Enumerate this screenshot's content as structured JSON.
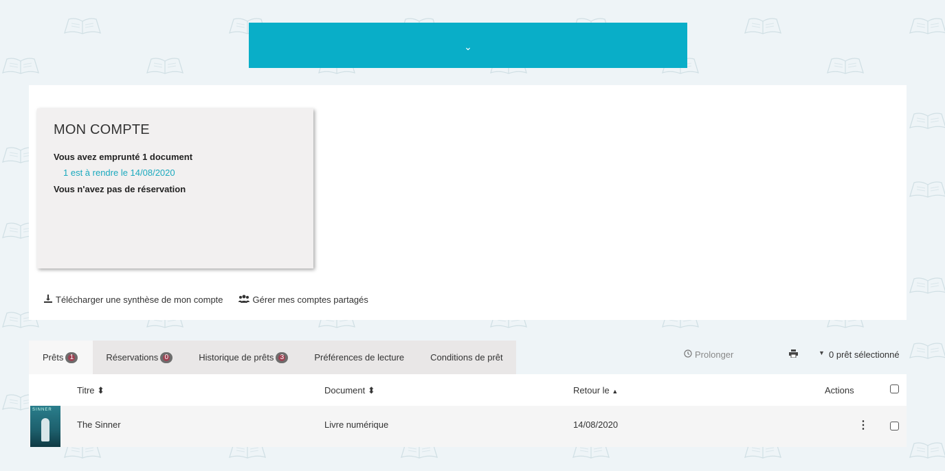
{
  "account": {
    "title": "MON COMPTE",
    "borrowed": "Vous avez emprunté 1 document",
    "due": "1 est à rendre le 14/08/2020",
    "reservations": "Vous n'avez pas de réservation"
  },
  "links": {
    "download": "Télécharger une synthèse de mon compte",
    "shared": "Gérer mes comptes partagés"
  },
  "tabs": [
    {
      "label": "Prêts",
      "badge": "1"
    },
    {
      "label": "Réservations",
      "badge": "0"
    },
    {
      "label": "Historique de prêts",
      "badge": "3"
    },
    {
      "label": "Préférences de lecture"
    },
    {
      "label": "Conditions de prêt"
    }
  ],
  "toolbar": {
    "prolonger": "Prolonger",
    "selection": "0 prêt sélectionné"
  },
  "table": {
    "headers": {
      "title": "Titre",
      "document": "Document",
      "return": "Retour le",
      "actions": "Actions"
    },
    "rows": [
      {
        "cover_caption": "SINNER",
        "title": "The Sinner",
        "document": "Livre numérique",
        "return": "14/08/2020"
      }
    ]
  },
  "colors": {
    "accent": "#09aec8",
    "link": "#1aa9be"
  }
}
